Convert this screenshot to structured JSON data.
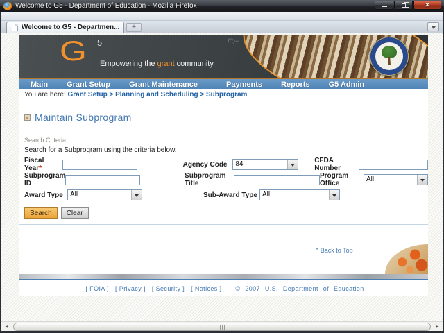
{
  "window": {
    "title": "Welcome to G5 - Department of Education - Mozilla Firefox",
    "close_glyph": "✕"
  },
  "tabbar": {
    "active_tab": "Welcome to G5 - Departmen...",
    "new_tab_label": "+"
  },
  "banner": {
    "logo": "G",
    "logo_sup": "5",
    "tagline_pre": "Empowering the ",
    "tagline_highlight": "grant",
    "tagline_post": " community.",
    "chalk_note": "f(t)≡"
  },
  "nav": {
    "items": [
      "Main",
      "Grant Setup",
      "Grant Maintenance",
      "Payments",
      "Reports",
      "G5 Admin"
    ]
  },
  "breadcrumb": {
    "prefix": "You are here:",
    "links": [
      "Grant Setup",
      "Planning and Scheduling",
      "Subprogram"
    ],
    "separator": ">"
  },
  "main": {
    "page_title": "Maintain Subprogram",
    "section_label": "Search Criteria",
    "instructions": "Search for a Subprogram using the criteria below.",
    "required_marker": "*",
    "fields": {
      "fiscal_year": {
        "label": "Fiscal Year",
        "value": ""
      },
      "agency_code": {
        "label": "Agency Code",
        "value": "84"
      },
      "cfda_number": {
        "label": "CFDA Number",
        "value": ""
      },
      "subprogram_id": {
        "label": "Subprogram ID",
        "value": ""
      },
      "subprogram_title": {
        "label": "Subprogram Title",
        "value": ""
      },
      "program_office": {
        "label": "Program Office",
        "value": "All"
      },
      "award_type": {
        "label": "Award Type",
        "value": "All"
      },
      "sub_award_type": {
        "label": "Sub-Award Type",
        "value": "All"
      }
    },
    "buttons": {
      "search": "Search",
      "clear": "Clear"
    },
    "back_to_top": "^ Back to Top"
  },
  "footer": {
    "links": [
      "[ FOIA ]",
      "[ Privacy ]",
      "[ Security ]",
      "[ Notices ]"
    ],
    "copyright": "© 2007 U.S. Department of Education"
  },
  "scrollbar": {
    "left_arrow": "◂",
    "right_arrow": "▸"
  },
  "colors": {
    "accent_orange": "#F0912D",
    "nav_blue": "#4D83B6",
    "link_blue": "#1D5FA7",
    "title_blue": "#4478B1",
    "input_border": "#7F9DB9",
    "search_button": "#EDA43B",
    "close_button_red": "#B13A20",
    "seal_blue": "#2A4A8E",
    "seal_green": "#2F6B24"
  }
}
